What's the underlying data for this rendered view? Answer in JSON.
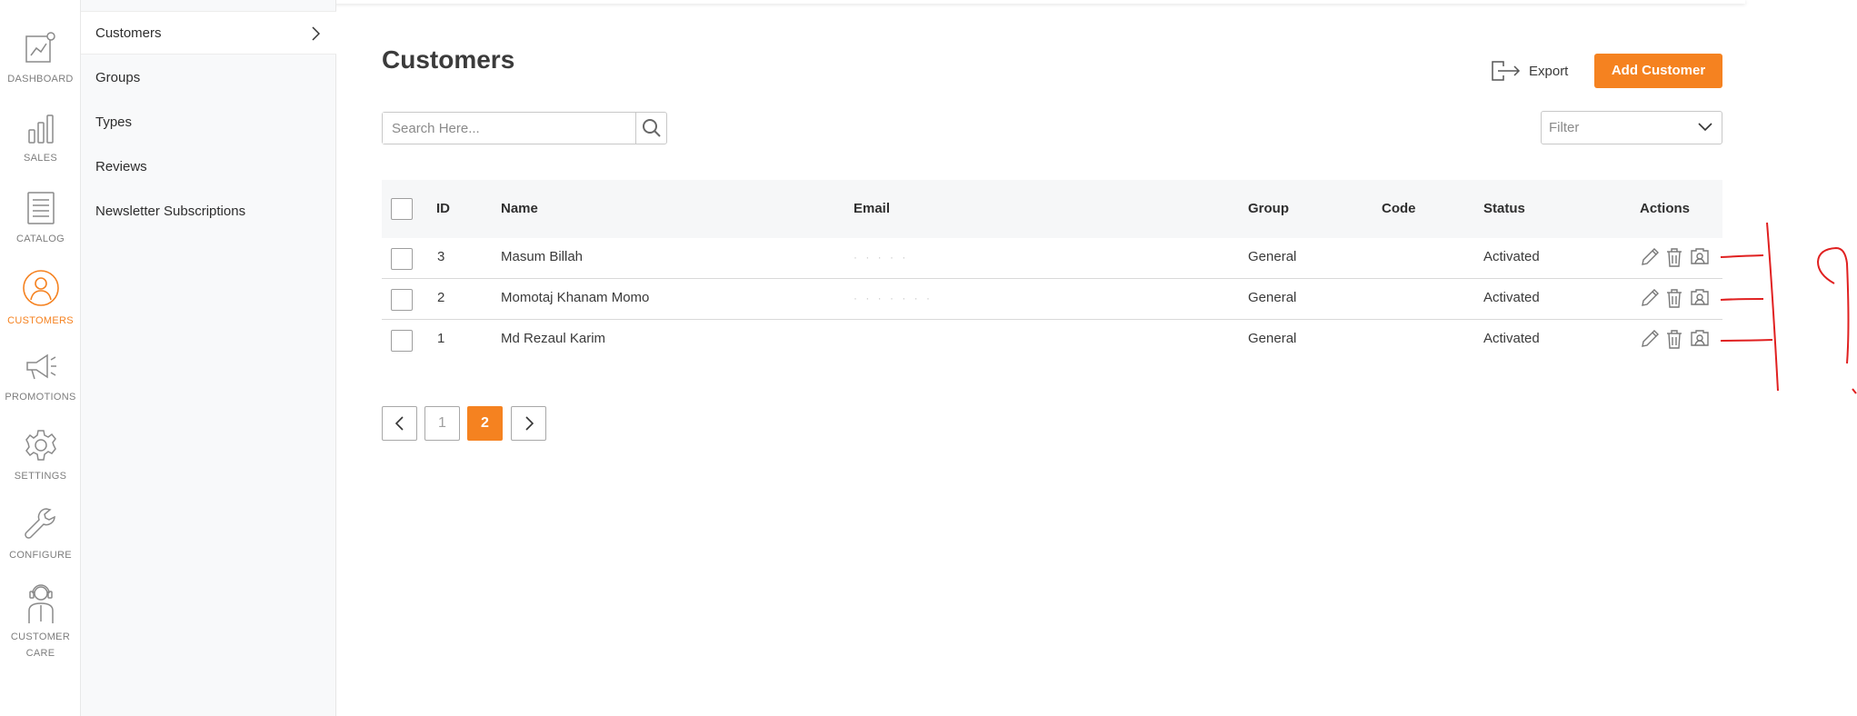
{
  "rail": [
    {
      "label": "DASHBOARD",
      "icon": "dashboard-icon"
    },
    {
      "label": "SALES",
      "icon": "sales-icon"
    },
    {
      "label": "CATALOG",
      "icon": "catalog-icon"
    },
    {
      "label": "CUSTOMERS",
      "icon": "customers-icon",
      "active": true
    },
    {
      "label": "PROMOTIONS",
      "icon": "megaphone-icon"
    },
    {
      "label": "SETTINGS",
      "icon": "gear-icon"
    },
    {
      "label": "CONFIGURE",
      "icon": "wrench-icon"
    },
    {
      "label": "CUSTOMER",
      "label2": "CARE",
      "icon": "customer-care-icon"
    }
  ],
  "subnav": {
    "items": [
      {
        "label": "Customers",
        "active": true
      },
      {
        "label": "Groups"
      },
      {
        "label": "Types"
      },
      {
        "label": "Reviews"
      },
      {
        "label": "Newsletter Subscriptions"
      }
    ]
  },
  "page": {
    "title": "Customers",
    "export_label": "Export",
    "add_label": "Add Customer",
    "search_placeholder": "Search Here...",
    "filter_label": "Filter"
  },
  "table": {
    "columns": {
      "id": "ID",
      "name": "Name",
      "email": "Email",
      "group": "Group",
      "code": "Code",
      "status": "Status",
      "actions": "Actions"
    },
    "rows": [
      {
        "id": "3",
        "name": "Masum Billah",
        "email": "",
        "group": "General",
        "code": "",
        "status": "Activated"
      },
      {
        "id": "2",
        "name": "Momotaj Khanam Momo",
        "email": "",
        "group": "General",
        "code": "",
        "status": "Activated"
      },
      {
        "id": "1",
        "name": "Md Rezaul Karim",
        "email": "",
        "group": "General",
        "code": "",
        "status": "Activated"
      }
    ]
  },
  "pagination": {
    "pages": [
      "1",
      "2"
    ],
    "current": "2"
  },
  "colors": {
    "accent": "#f58220",
    "rail_icon": "#8a8a8a",
    "annotation": "#e02020"
  }
}
